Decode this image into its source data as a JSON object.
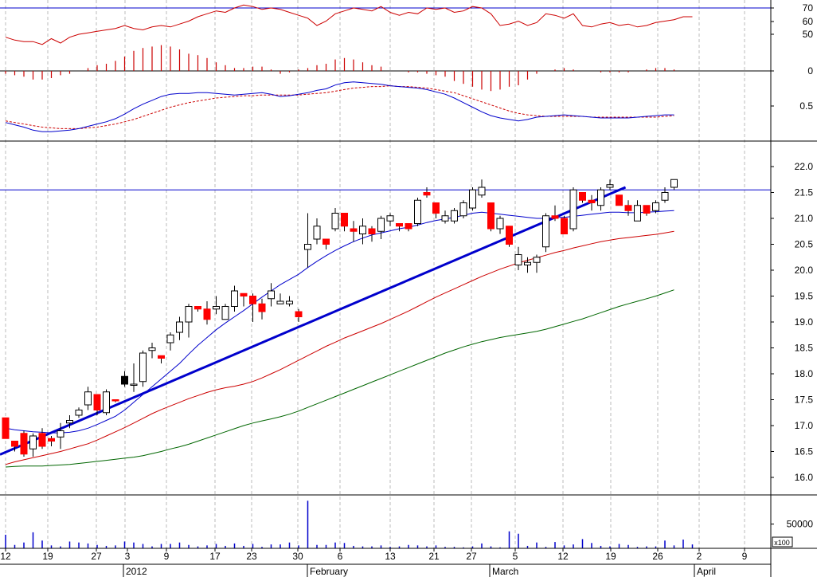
{
  "chart_data": {
    "type": "candlestick",
    "title": "",
    "colors": {
      "up": "#ffffff",
      "down": "#ff0000",
      "wick": "#000000",
      "sma_fast": "#0000cc",
      "sma_mid": "#cc0000",
      "sma_slow": "#006600",
      "trendline": "#0000cc",
      "resistance": "#0000cc",
      "rsi": "#cc0000",
      "macd": "#0000cc",
      "macd_signal": "#cc0000",
      "histogram": "#cc0000",
      "volume": "#0000cc",
      "grid": "#bbbbbb"
    },
    "x_axis": {
      "day_labels": [
        "12",
        "19",
        "27",
        "3",
        "9",
        "17",
        "23",
        "30",
        "6",
        "13",
        "21",
        "27",
        "5",
        "12",
        "19",
        "26",
        "2",
        "9"
      ],
      "month_labels": [
        "2012",
        "February",
        "March",
        "April"
      ]
    },
    "price_panel": {
      "y_ticks": [
        "16.0",
        "16.5",
        "17.0",
        "17.5",
        "18.0",
        "18.5",
        "19.0",
        "19.5",
        "20.0",
        "20.5",
        "21.0",
        "21.5",
        "22.0"
      ],
      "ylim": [
        15.75,
        22.3
      ],
      "resistance_level": 21.55,
      "trendline": {
        "start": [
          0,
          16.44
        ],
        "end": [
          67.7,
          21.6
        ]
      },
      "candles": [
        [
          17.15,
          17.15,
          16.75,
          16.75
        ],
        [
          16.7,
          16.7,
          16.5,
          16.6
        ],
        [
          16.85,
          16.9,
          16.4,
          16.45
        ],
        [
          16.55,
          16.85,
          16.4,
          16.8
        ],
        [
          16.85,
          16.95,
          16.55,
          16.6
        ],
        [
          16.75,
          16.8,
          16.6,
          16.7
        ],
        [
          16.78,
          17.05,
          16.55,
          16.9
        ],
        [
          17.05,
          17.2,
          16.95,
          17.1
        ],
        [
          17.2,
          17.35,
          17.15,
          17.3
        ],
        [
          17.4,
          17.75,
          17.3,
          17.65
        ],
        [
          17.6,
          17.6,
          17.2,
          17.3
        ],
        [
          17.25,
          17.7,
          17.2,
          17.65
        ],
        [
          17.5,
          17.5,
          17.45,
          17.48
        ],
        [
          17.95,
          18.05,
          17.75,
          17.8
        ],
        [
          17.8,
          18.2,
          17.65,
          17.8
        ],
        [
          17.85,
          18.45,
          17.75,
          18.4
        ],
        [
          18.45,
          18.6,
          18.3,
          18.5
        ],
        [
          18.35,
          18.35,
          18.2,
          18.3
        ],
        [
          18.6,
          18.8,
          18.45,
          18.75
        ],
        [
          18.8,
          19.1,
          18.65,
          19.0
        ],
        [
          19.0,
          19.35,
          18.7,
          19.3
        ],
        [
          19.3,
          19.3,
          19.2,
          19.25
        ],
        [
          19.25,
          19.4,
          18.95,
          19.05
        ],
        [
          19.25,
          19.5,
          19.15,
          19.3
        ],
        [
          19.05,
          19.35,
          19.05,
          19.3
        ],
        [
          19.3,
          19.7,
          19.2,
          19.6
        ],
        [
          19.55,
          19.55,
          19.3,
          19.5
        ],
        [
          19.5,
          19.55,
          19.0,
          19.35
        ],
        [
          19.35,
          19.45,
          19.05,
          19.2
        ],
        [
          19.45,
          19.75,
          19.3,
          19.6
        ],
        [
          19.35,
          19.55,
          19.35,
          19.4
        ],
        [
          19.35,
          19.5,
          19.3,
          19.4
        ],
        [
          19.2,
          19.25,
          19.0,
          19.1
        ],
        [
          20.4,
          21.1,
          20.05,
          20.5
        ],
        [
          20.6,
          21.0,
          20.5,
          20.85
        ],
        [
          20.6,
          20.6,
          20.4,
          20.5
        ],
        [
          20.8,
          21.2,
          20.75,
          21.1
        ],
        [
          21.1,
          21.1,
          20.75,
          20.85
        ],
        [
          20.8,
          20.95,
          20.55,
          20.75
        ],
        [
          20.7,
          21.0,
          20.5,
          20.85
        ],
        [
          20.8,
          20.85,
          20.55,
          20.7
        ],
        [
          20.75,
          21.05,
          20.6,
          21.0
        ],
        [
          20.95,
          21.1,
          20.85,
          21.05
        ],
        [
          20.9,
          20.9,
          20.75,
          20.85
        ],
        [
          20.9,
          20.9,
          20.75,
          20.8
        ],
        [
          20.9,
          21.4,
          20.85,
          21.35
        ],
        [
          21.5,
          21.6,
          21.4,
          21.45
        ],
        [
          21.3,
          21.3,
          21.0,
          21.1
        ],
        [
          20.95,
          21.15,
          20.9,
          21.05
        ],
        [
          20.95,
          21.2,
          20.9,
          21.15
        ],
        [
          21.05,
          21.35,
          21.0,
          21.3
        ],
        [
          21.2,
          21.6,
          21.15,
          21.55
        ],
        [
          21.45,
          21.75,
          21.4,
          21.6
        ],
        [
          21.3,
          21.3,
          20.75,
          20.8
        ],
        [
          20.8,
          21.05,
          20.7,
          21.0
        ],
        [
          20.85,
          20.85,
          20.45,
          20.5
        ],
        [
          20.1,
          20.45,
          20.0,
          20.3
        ],
        [
          20.1,
          20.25,
          19.95,
          20.15
        ],
        [
          20.15,
          20.3,
          19.95,
          20.25
        ],
        [
          20.45,
          21.1,
          20.35,
          21.05
        ],
        [
          21.05,
          21.25,
          20.95,
          21.0
        ],
        [
          21.0,
          21.05,
          20.7,
          20.7
        ],
        [
          20.8,
          21.6,
          20.75,
          21.55
        ],
        [
          21.5,
          21.5,
          21.3,
          21.35
        ],
        [
          21.35,
          21.45,
          21.15,
          21.3
        ],
        [
          21.25,
          21.6,
          21.15,
          21.55
        ],
        [
          21.6,
          21.75,
          21.55,
          21.65
        ],
        [
          21.45,
          21.45,
          21.25,
          21.25
        ],
        [
          21.25,
          21.35,
          21.05,
          21.15
        ],
        [
          20.95,
          21.35,
          20.95,
          21.25
        ],
        [
          21.25,
          21.25,
          21.05,
          21.1
        ],
        [
          21.15,
          21.35,
          21.1,
          21.3
        ],
        [
          21.35,
          21.6,
          21.3,
          21.5
        ],
        [
          21.6,
          21.75,
          21.55,
          21.75
        ]
      ],
      "sma_fast": [
        16.95,
        16.92,
        16.9,
        16.88,
        16.87,
        16.86,
        16.86,
        16.87,
        16.9,
        16.95,
        17.02,
        17.1,
        17.18,
        17.3,
        17.45,
        17.6,
        17.75,
        17.9,
        18.05,
        18.2,
        18.38,
        18.55,
        18.7,
        18.85,
        18.98,
        19.1,
        19.22,
        19.35,
        19.48,
        19.6,
        19.72,
        19.82,
        19.92,
        20.05,
        20.17,
        20.28,
        20.38,
        20.47,
        20.55,
        20.62,
        20.68,
        20.72,
        20.76,
        20.8,
        20.83,
        20.87,
        20.92,
        20.96,
        20.99,
        21.02,
        21.06,
        21.1,
        21.12,
        21.1,
        21.08,
        21.06,
        21.04,
        21.02,
        21.0,
        21.0,
        21.02,
        21.02,
        21.04,
        21.06,
        21.08,
        21.1,
        21.12,
        21.12,
        21.11,
        21.11,
        21.12,
        21.13,
        21.14,
        21.15
      ],
      "sma_mid": [
        16.25,
        16.3,
        16.34,
        16.38,
        16.42,
        16.46,
        16.5,
        16.55,
        16.6,
        16.65,
        16.72,
        16.8,
        16.88,
        16.96,
        17.05,
        17.14,
        17.23,
        17.31,
        17.38,
        17.45,
        17.52,
        17.58,
        17.64,
        17.69,
        17.73,
        17.76,
        17.8,
        17.85,
        17.92,
        18.0,
        18.08,
        18.17,
        18.26,
        18.35,
        18.44,
        18.53,
        18.61,
        18.69,
        18.76,
        18.83,
        18.9,
        18.97,
        19.05,
        19.13,
        19.21,
        19.3,
        19.39,
        19.48,
        19.56,
        19.64,
        19.72,
        19.8,
        19.88,
        19.95,
        20.02,
        20.08,
        20.14,
        20.19,
        20.24,
        20.29,
        20.34,
        20.38,
        20.43,
        20.47,
        20.51,
        20.55,
        20.58,
        20.61,
        20.63,
        20.65,
        20.67,
        20.69,
        20.72,
        20.75
      ],
      "sma_slow": [
        16.2,
        16.21,
        16.22,
        16.22,
        16.22,
        16.23,
        16.24,
        16.25,
        16.27,
        16.29,
        16.31,
        16.33,
        16.35,
        16.37,
        16.39,
        16.42,
        16.46,
        16.5,
        16.55,
        16.59,
        16.64,
        16.7,
        16.76,
        16.82,
        16.88,
        16.94,
        17.0,
        17.05,
        17.09,
        17.13,
        17.17,
        17.22,
        17.28,
        17.35,
        17.42,
        17.49,
        17.56,
        17.63,
        17.7,
        17.77,
        17.84,
        17.91,
        17.98,
        18.05,
        18.12,
        18.19,
        18.26,
        18.33,
        18.4,
        18.46,
        18.52,
        18.57,
        18.62,
        18.66,
        18.7,
        18.73,
        18.76,
        18.79,
        18.82,
        18.86,
        18.91,
        18.96,
        19.01,
        19.06,
        19.12,
        19.18,
        19.24,
        19.3,
        19.35,
        19.4,
        19.45,
        19.5,
        19.56,
        19.62
      ]
    },
    "rsi_panel": {
      "y_ticks": [
        "70",
        "60",
        "50"
      ],
      "ylim": [
        25,
        75
      ],
      "overbought_line": 70,
      "values": [
        50,
        48,
        47,
        47,
        45,
        49,
        46,
        50,
        52,
        53,
        54,
        55,
        56,
        58,
        56,
        55,
        57,
        58,
        57,
        59,
        61,
        64,
        66,
        68,
        67,
        70,
        72,
        71,
        69,
        70,
        69,
        67,
        65,
        63,
        58,
        61,
        66,
        68,
        70,
        69,
        68,
        71,
        67,
        65,
        67,
        66,
        70,
        69,
        70,
        67,
        68,
        71,
        70,
        66,
        58,
        59,
        61,
        58,
        60,
        66,
        65,
        63,
        66,
        58,
        57,
        59,
        60,
        58,
        59,
        57,
        58,
        60,
        61,
        62,
        64,
        64
      ]
    },
    "macd_panel": {
      "y_ticks": [
        "0",
        "0.5"
      ],
      "ylim": [
        0,
        0.9
      ],
      "zero_line": 0,
      "macd": [
        0.18,
        0.15,
        0.12,
        0.08,
        0.06,
        0.06,
        0.07,
        0.08,
        0.1,
        0.13,
        0.16,
        0.19,
        0.23,
        0.29,
        0.36,
        0.42,
        0.47,
        0.52,
        0.55,
        0.56,
        0.56,
        0.57,
        0.57,
        0.56,
        0.55,
        0.54,
        0.55,
        0.56,
        0.57,
        0.55,
        0.52,
        0.53,
        0.55,
        0.57,
        0.6,
        0.62,
        0.67,
        0.7,
        0.71,
        0.7,
        0.69,
        0.68,
        0.66,
        0.65,
        0.64,
        0.63,
        0.61,
        0.58,
        0.55,
        0.5,
        0.44,
        0.38,
        0.32,
        0.27,
        0.24,
        0.22,
        0.2,
        0.22,
        0.25,
        0.26,
        0.27,
        0.28,
        0.27,
        0.26,
        0.25,
        0.24,
        0.24,
        0.24,
        0.24,
        0.25,
        0.26,
        0.27,
        0.28,
        0.28
      ],
      "signal": [
        0.2,
        0.18,
        0.16,
        0.14,
        0.12,
        0.11,
        0.1,
        0.1,
        0.1,
        0.11,
        0.12,
        0.14,
        0.16,
        0.19,
        0.22,
        0.26,
        0.3,
        0.34,
        0.38,
        0.41,
        0.44,
        0.46,
        0.48,
        0.5,
        0.51,
        0.52,
        0.53,
        0.53,
        0.54,
        0.54,
        0.54,
        0.54,
        0.54,
        0.55,
        0.56,
        0.57,
        0.59,
        0.61,
        0.63,
        0.64,
        0.65,
        0.65,
        0.66,
        0.65,
        0.65,
        0.64,
        0.63,
        0.61,
        0.59,
        0.57,
        0.53,
        0.49,
        0.45,
        0.41,
        0.37,
        0.33,
        0.3,
        0.28,
        0.27,
        0.26,
        0.26,
        0.26,
        0.26,
        0.26,
        0.25,
        0.25,
        0.25,
        0.25,
        0.25,
        0.25,
        0.25,
        0.25,
        0.26,
        0.27
      ]
    },
    "volume_panel": {
      "y_ticks": [
        "50000"
      ],
      "multiplier_label": "x100",
      "ylim": [
        0,
        110000
      ],
      "values": [
        28000,
        7000,
        12000,
        33000,
        16000,
        6000,
        4000,
        14000,
        12000,
        10000,
        7000,
        5000,
        6000,
        14000,
        12000,
        9000,
        4000,
        9000,
        9000,
        12000,
        7000,
        4000,
        6000,
        9000,
        5000,
        10000,
        5000,
        9000,
        3000,
        8000,
        8000,
        12000,
        6000,
        98000,
        7000,
        7000,
        12000,
        11000,
        5000,
        4000,
        4000,
        6000,
        3000,
        4000,
        7000,
        6000,
        4000,
        6000,
        3000,
        3000,
        2000,
        4000,
        10000,
        4000,
        2000,
        35000,
        30000,
        5000,
        12000,
        3000,
        13000,
        6000,
        8000,
        19000,
        11000,
        5000,
        4000,
        9000,
        7000,
        3000,
        4000,
        4000,
        16000,
        6000,
        18000,
        8000
      ]
    }
  }
}
